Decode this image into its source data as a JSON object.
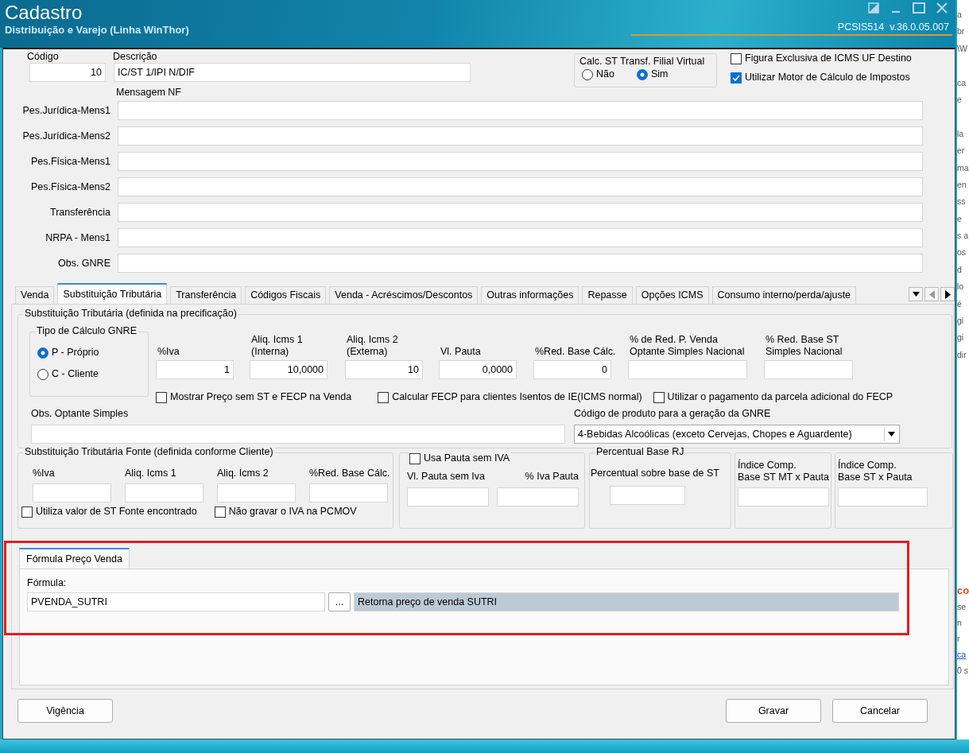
{
  "window": {
    "title": "Cadastro",
    "subtitle": "Distribuição e Varejo (Linha WinThor)",
    "version": "PCSIS514  v.36.0.05.007"
  },
  "header": {
    "fields": [
      {
        "label": "Código",
        "value": "10"
      },
      {
        "label": "Descrição",
        "value": "IC/ST 1/IPI N/DIF"
      }
    ],
    "calc_st": {
      "label": "Calc. ST Transf. Filial Virtual",
      "options": [
        {
          "label": "Não",
          "selected": false
        },
        {
          "label": "Sim",
          "selected": true
        }
      ]
    },
    "checkboxes": [
      {
        "label": "Figura Exclusiva de ICMS UF Destino",
        "checked": false
      },
      {
        "label": "Utilizar Motor de Cálculo de Impostos",
        "checked": true
      }
    ]
  },
  "messages": {
    "title": "Mensagem NF",
    "rows": [
      {
        "label": "Pes.Jurídica-Mens1"
      },
      {
        "label": "Pes.Jurídica-Mens2"
      },
      {
        "label": "Pes.Física-Mens1"
      },
      {
        "label": "Pes.Física-Mens2"
      },
      {
        "label": "Transferência"
      },
      {
        "label": "NRPA - Mens1"
      },
      {
        "label": "Obs. GNRE"
      }
    ]
  },
  "tabs": [
    {
      "label": "Venda",
      "selected": false
    },
    {
      "label": "Substituição Tributária",
      "selected": true
    },
    {
      "label": "Transferência",
      "selected": false
    },
    {
      "label": "Códigos Fiscais",
      "selected": false
    },
    {
      "label": "Venda - Acréscimos/Descontos",
      "selected": false
    },
    {
      "label": "Outras informações",
      "selected": false
    },
    {
      "label": "Repasse",
      "selected": false
    },
    {
      "label": "Opções ICMS",
      "selected": false
    },
    {
      "label": "Consumo interno/perda/ajuste",
      "selected": false
    }
  ],
  "tab_scroll_buttons": [
    {
      "disabled": true
    },
    {
      "disabled": false
    }
  ],
  "st_group": {
    "title": "Substituição Tributária (definida na precificação)",
    "gnre_type": {
      "label": "Tipo de Cálculo GNRE",
      "options": [
        {
          "label": "P - Próprio",
          "selected": true
        },
        {
          "label": "C - Cliente",
          "selected": false
        }
      ]
    },
    "fields": [
      {
        "label": "%Iva",
        "value": "1"
      },
      {
        "label": "Aliq. Icms 1\n(Interna)",
        "value": "10,0000"
      },
      {
        "label": "Aliq. Icms 2\n(Externa)",
        "value": "10"
      },
      {
        "label": "Vl. Pauta",
        "value": "0,0000"
      },
      {
        "label": "%Red. Base Cálc.",
        "value": "0"
      },
      {
        "label": "% de Red. P. Venda\nOptante Simples Nacional"
      },
      {
        "label": "% Red. Base ST\nSimples Nacional"
      }
    ],
    "checkboxes": [
      {
        "label": "Mostrar Preço sem ST e FECP na Venda",
        "checked": false
      },
      {
        "label": "Calcular FECP para clientes Isentos de IE(ICMS normal)",
        "checked": false
      },
      {
        "label": "Utilizar o pagamento da parcela adicional do FECP",
        "checked": false
      }
    ],
    "obs": {
      "label": "Obs. Optante Simples"
    },
    "gnre_product": {
      "label": "Código de produto para a geração da GNRE",
      "value": "4-Bebidas Alcoólicas (exceto Cervejas, Chopes e Aguardente)"
    }
  },
  "st_fonte": {
    "title": "Substituição Tributária Fonte (definida conforme Cliente)",
    "fields": [
      {
        "label": "%Iva"
      },
      {
        "label": "Aliq. Icms 1"
      },
      {
        "label": "Aliq. Icms 2"
      },
      {
        "label": "%Red. Base Cálc."
      }
    ],
    "checkboxes": [
      {
        "label": "Utiliza valor de ST Fonte encontrado",
        "checked": false
      },
      {
        "label": "Não gravar o IVA na PCMOV",
        "checked": false
      }
    ]
  },
  "pauta": {
    "label": "Usa Pauta sem IVA",
    "checked": false,
    "fields": [
      {
        "label": "Vl. Pauta sem Iva"
      },
      {
        "label": "% Iva Pauta"
      }
    ]
  },
  "base_rj": {
    "title": "Percentual Base RJ",
    "fields": [
      {
        "label": "Percentual sobre base de ST"
      }
    ]
  },
  "indices": [
    {
      "label": "Índice Comp.\nBase ST MT x Pauta"
    },
    {
      "label": "Índice Comp.\nBase ST x Pauta"
    }
  ],
  "formula": {
    "highlighted": true,
    "tab": {
      "label": "Fórmula Preço Venda",
      "selected": true
    },
    "label": "Fórmula:",
    "value": "PVENDA_SUTRI",
    "browse": "...",
    "description": "Retorna preço de venda SUTRI"
  },
  "buttons": [
    {
      "label": "Vigência"
    },
    {
      "label": "Gravar"
    },
    {
      "label": "Cancelar"
    }
  ],
  "background_text": {
    "top": [
      [
        "a",
        "br",
        "\\W"
      ],
      [
        "ca",
        "e"
      ],
      [
        "la",
        "er",
        "ma",
        "en",
        "ss",
        "e",
        "s a",
        "os",
        "d",
        "lo",
        "é",
        "gi",
        "gi",
        "dir"
      ]
    ],
    "bottom": [
      {
        "text": "co",
        "kind": "heading"
      },
      {
        "text": "se",
        "kind": "text"
      },
      {
        "text": "n",
        "kind": "text"
      },
      {
        "text": "r",
        "kind": "text"
      },
      {
        "text": "ca",
        "kind": "link"
      },
      {
        "text": "0 s",
        "kind": "text"
      }
    ]
  }
}
